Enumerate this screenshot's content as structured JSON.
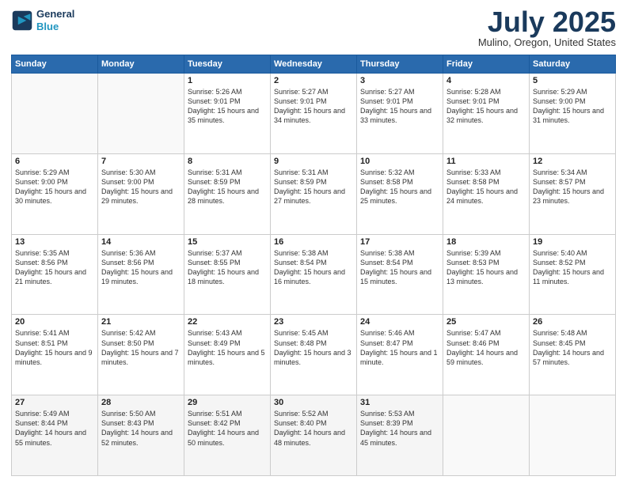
{
  "header": {
    "logo_line1": "General",
    "logo_line2": "Blue",
    "month": "July 2025",
    "location": "Mulino, Oregon, United States"
  },
  "weekdays": [
    "Sunday",
    "Monday",
    "Tuesday",
    "Wednesday",
    "Thursday",
    "Friday",
    "Saturday"
  ],
  "weeks": [
    [
      {
        "day": "",
        "info": ""
      },
      {
        "day": "",
        "info": ""
      },
      {
        "day": "1",
        "info": "Sunrise: 5:26 AM\nSunset: 9:01 PM\nDaylight: 15 hours and 35 minutes."
      },
      {
        "day": "2",
        "info": "Sunrise: 5:27 AM\nSunset: 9:01 PM\nDaylight: 15 hours and 34 minutes."
      },
      {
        "day": "3",
        "info": "Sunrise: 5:27 AM\nSunset: 9:01 PM\nDaylight: 15 hours and 33 minutes."
      },
      {
        "day": "4",
        "info": "Sunrise: 5:28 AM\nSunset: 9:01 PM\nDaylight: 15 hours and 32 minutes."
      },
      {
        "day": "5",
        "info": "Sunrise: 5:29 AM\nSunset: 9:00 PM\nDaylight: 15 hours and 31 minutes."
      }
    ],
    [
      {
        "day": "6",
        "info": "Sunrise: 5:29 AM\nSunset: 9:00 PM\nDaylight: 15 hours and 30 minutes."
      },
      {
        "day": "7",
        "info": "Sunrise: 5:30 AM\nSunset: 9:00 PM\nDaylight: 15 hours and 29 minutes."
      },
      {
        "day": "8",
        "info": "Sunrise: 5:31 AM\nSunset: 8:59 PM\nDaylight: 15 hours and 28 minutes."
      },
      {
        "day": "9",
        "info": "Sunrise: 5:31 AM\nSunset: 8:59 PM\nDaylight: 15 hours and 27 minutes."
      },
      {
        "day": "10",
        "info": "Sunrise: 5:32 AM\nSunset: 8:58 PM\nDaylight: 15 hours and 25 minutes."
      },
      {
        "day": "11",
        "info": "Sunrise: 5:33 AM\nSunset: 8:58 PM\nDaylight: 15 hours and 24 minutes."
      },
      {
        "day": "12",
        "info": "Sunrise: 5:34 AM\nSunset: 8:57 PM\nDaylight: 15 hours and 23 minutes."
      }
    ],
    [
      {
        "day": "13",
        "info": "Sunrise: 5:35 AM\nSunset: 8:56 PM\nDaylight: 15 hours and 21 minutes."
      },
      {
        "day": "14",
        "info": "Sunrise: 5:36 AM\nSunset: 8:56 PM\nDaylight: 15 hours and 19 minutes."
      },
      {
        "day": "15",
        "info": "Sunrise: 5:37 AM\nSunset: 8:55 PM\nDaylight: 15 hours and 18 minutes."
      },
      {
        "day": "16",
        "info": "Sunrise: 5:38 AM\nSunset: 8:54 PM\nDaylight: 15 hours and 16 minutes."
      },
      {
        "day": "17",
        "info": "Sunrise: 5:38 AM\nSunset: 8:54 PM\nDaylight: 15 hours and 15 minutes."
      },
      {
        "day": "18",
        "info": "Sunrise: 5:39 AM\nSunset: 8:53 PM\nDaylight: 15 hours and 13 minutes."
      },
      {
        "day": "19",
        "info": "Sunrise: 5:40 AM\nSunset: 8:52 PM\nDaylight: 15 hours and 11 minutes."
      }
    ],
    [
      {
        "day": "20",
        "info": "Sunrise: 5:41 AM\nSunset: 8:51 PM\nDaylight: 15 hours and 9 minutes."
      },
      {
        "day": "21",
        "info": "Sunrise: 5:42 AM\nSunset: 8:50 PM\nDaylight: 15 hours and 7 minutes."
      },
      {
        "day": "22",
        "info": "Sunrise: 5:43 AM\nSunset: 8:49 PM\nDaylight: 15 hours and 5 minutes."
      },
      {
        "day": "23",
        "info": "Sunrise: 5:45 AM\nSunset: 8:48 PM\nDaylight: 15 hours and 3 minutes."
      },
      {
        "day": "24",
        "info": "Sunrise: 5:46 AM\nSunset: 8:47 PM\nDaylight: 15 hours and 1 minute."
      },
      {
        "day": "25",
        "info": "Sunrise: 5:47 AM\nSunset: 8:46 PM\nDaylight: 14 hours and 59 minutes."
      },
      {
        "day": "26",
        "info": "Sunrise: 5:48 AM\nSunset: 8:45 PM\nDaylight: 14 hours and 57 minutes."
      }
    ],
    [
      {
        "day": "27",
        "info": "Sunrise: 5:49 AM\nSunset: 8:44 PM\nDaylight: 14 hours and 55 minutes."
      },
      {
        "day": "28",
        "info": "Sunrise: 5:50 AM\nSunset: 8:43 PM\nDaylight: 14 hours and 52 minutes."
      },
      {
        "day": "29",
        "info": "Sunrise: 5:51 AM\nSunset: 8:42 PM\nDaylight: 14 hours and 50 minutes."
      },
      {
        "day": "30",
        "info": "Sunrise: 5:52 AM\nSunset: 8:40 PM\nDaylight: 14 hours and 48 minutes."
      },
      {
        "day": "31",
        "info": "Sunrise: 5:53 AM\nSunset: 8:39 PM\nDaylight: 14 hours and 45 minutes."
      },
      {
        "day": "",
        "info": ""
      },
      {
        "day": "",
        "info": ""
      }
    ]
  ]
}
